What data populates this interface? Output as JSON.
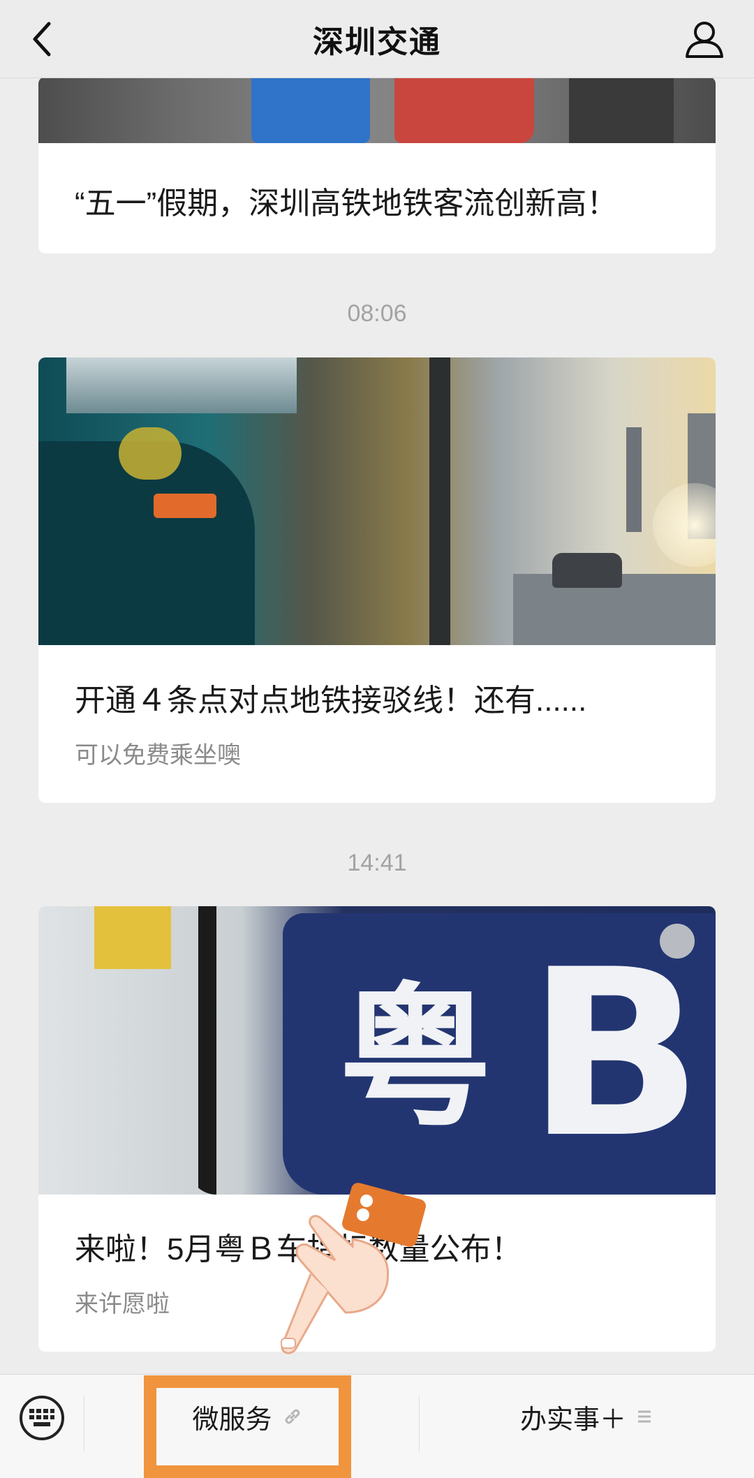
{
  "header": {
    "title": "深圳交通",
    "back_icon": "chevron-left-icon",
    "profile_icon": "user-icon"
  },
  "feed": {
    "card1": {
      "title": "“五一”假期，深圳高铁地铁客流创新高！"
    },
    "timestamp1": "08:06",
    "card2": {
      "title": "开通４条点对点地铁接驳线！还有......",
      "subtitle": "可以免费乘坐噢"
    },
    "timestamp2": "14:41",
    "card3": {
      "title": "来啦！5月粤Ｂ车指标数量公布！",
      "subtitle": "来许愿啦",
      "plate_chars": [
        "粤",
        "B"
      ]
    }
  },
  "bottom_menu": {
    "keyboard_icon": "keyboard-icon",
    "micro_service": "微服务",
    "micro_service_icon": "link-icon",
    "office_affairs": "办实事＋",
    "office_affairs_icon": "menu-lines-icon"
  },
  "colors": {
    "highlight": "#f0943e",
    "background": "#ededed"
  }
}
